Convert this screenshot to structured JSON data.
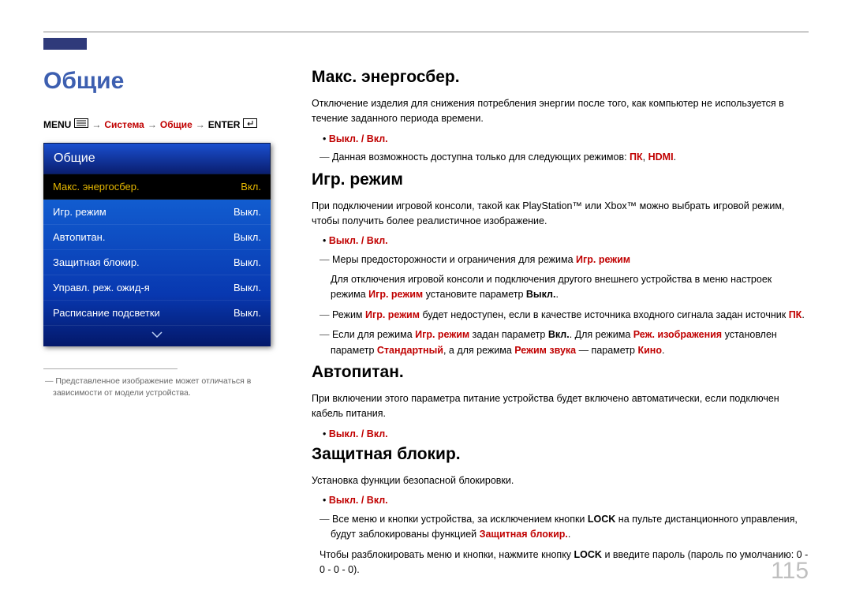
{
  "page_number": "115",
  "section_title": "Общие",
  "breadcrumb": {
    "menu": "MENU",
    "system": "Система",
    "general": "Общие",
    "enter": "ENTER",
    "arrow": "→"
  },
  "osd": {
    "title": "Общие",
    "rows": [
      {
        "label": "Макс. энергосбер.",
        "value": "Вкл.",
        "selected": true
      },
      {
        "label": "Игр. режим",
        "value": "Выкл.",
        "selected": false
      },
      {
        "label": "Автопитан.",
        "value": "Выкл.",
        "selected": false
      },
      {
        "label": "Защитная блокир.",
        "value": "Выкл.",
        "selected": false
      },
      {
        "label": "Управл. реж. ожид-я",
        "value": "Выкл.",
        "selected": false
      },
      {
        "label": "Расписание подсветки",
        "value": "Выкл.",
        "selected": false
      }
    ]
  },
  "footnote": "Представленное изображение может отличаться в зависимости от модели устройства.",
  "text": {
    "sec1_h": "Макс. энергосбер.",
    "sec1_p": "Отключение изделия для снижения потребления энергии после того, как компьютер не используется в течение заданного периода времени.",
    "off_on": "Выкл. / Вкл.",
    "sec1_dash": "Данная возможность доступна только для следующих режимов: ",
    "pk": "ПК",
    "hdmi": "HDMI",
    "comma": ", ",
    "period": ".",
    "sec2_h": "Игр. режим",
    "sec2_p": "При подключении игровой консоли, такой как PlayStation™ или Xbox™ можно выбрать игровой режим, чтобы получить более реалистичное изображение.",
    "sec2_d1_a": "Меры предосторожности и ограничения для режима ",
    "game_mode": "Игр. режим",
    "sec2_d1_sub_a": "Для отключения игровой консоли и подключения другого внешнего устройства в меню настроек режима ",
    "sec2_d1_sub_b": " установите параметр ",
    "off": "Выкл.",
    "sec2_d2_a": "Режим ",
    "sec2_d2_b": " будет недоступен, если в качестве источника входного сигнала задан источник ",
    "sec2_d3_a": "Если для режима ",
    "sec2_d3_b": " задан параметр ",
    "on": "Вкл.",
    "sec2_d3_c": ". Для режима ",
    "picmode": "Реж. изображения",
    "sec2_d3_d": " установлен параметр ",
    "standard": "Стандартный",
    "sec2_d3_e": ", а для режима ",
    "soundmode": "Режим звука",
    "sec2_d3_f": " — параметр ",
    "cinema": "Кино",
    "sec3_h": "Автопитан.",
    "sec3_p": "При включении этого параметра питание устройства будет включено автоматически, если подключен кабель питания.",
    "sec4_h": "Защитная блокир.",
    "sec4_p": "Установка функции безопасной блокировки.",
    "sec4_d1_a": "Все меню и кнопки устройства, за исключением кнопки ",
    "lock": "LOCK",
    "sec4_d1_b": " на пульте дистанционного управления, будут заблокированы функцией ",
    "safe_lock": "Защитная блокир.",
    "sec4_d1_c": ".",
    "sec4_p2_a": "Чтобы разблокировать меню и кнопки, нажмите кнопку ",
    "sec4_p2_b": " и введите пароль (пароль по умолчанию: 0 - 0 - 0 - 0)."
  }
}
